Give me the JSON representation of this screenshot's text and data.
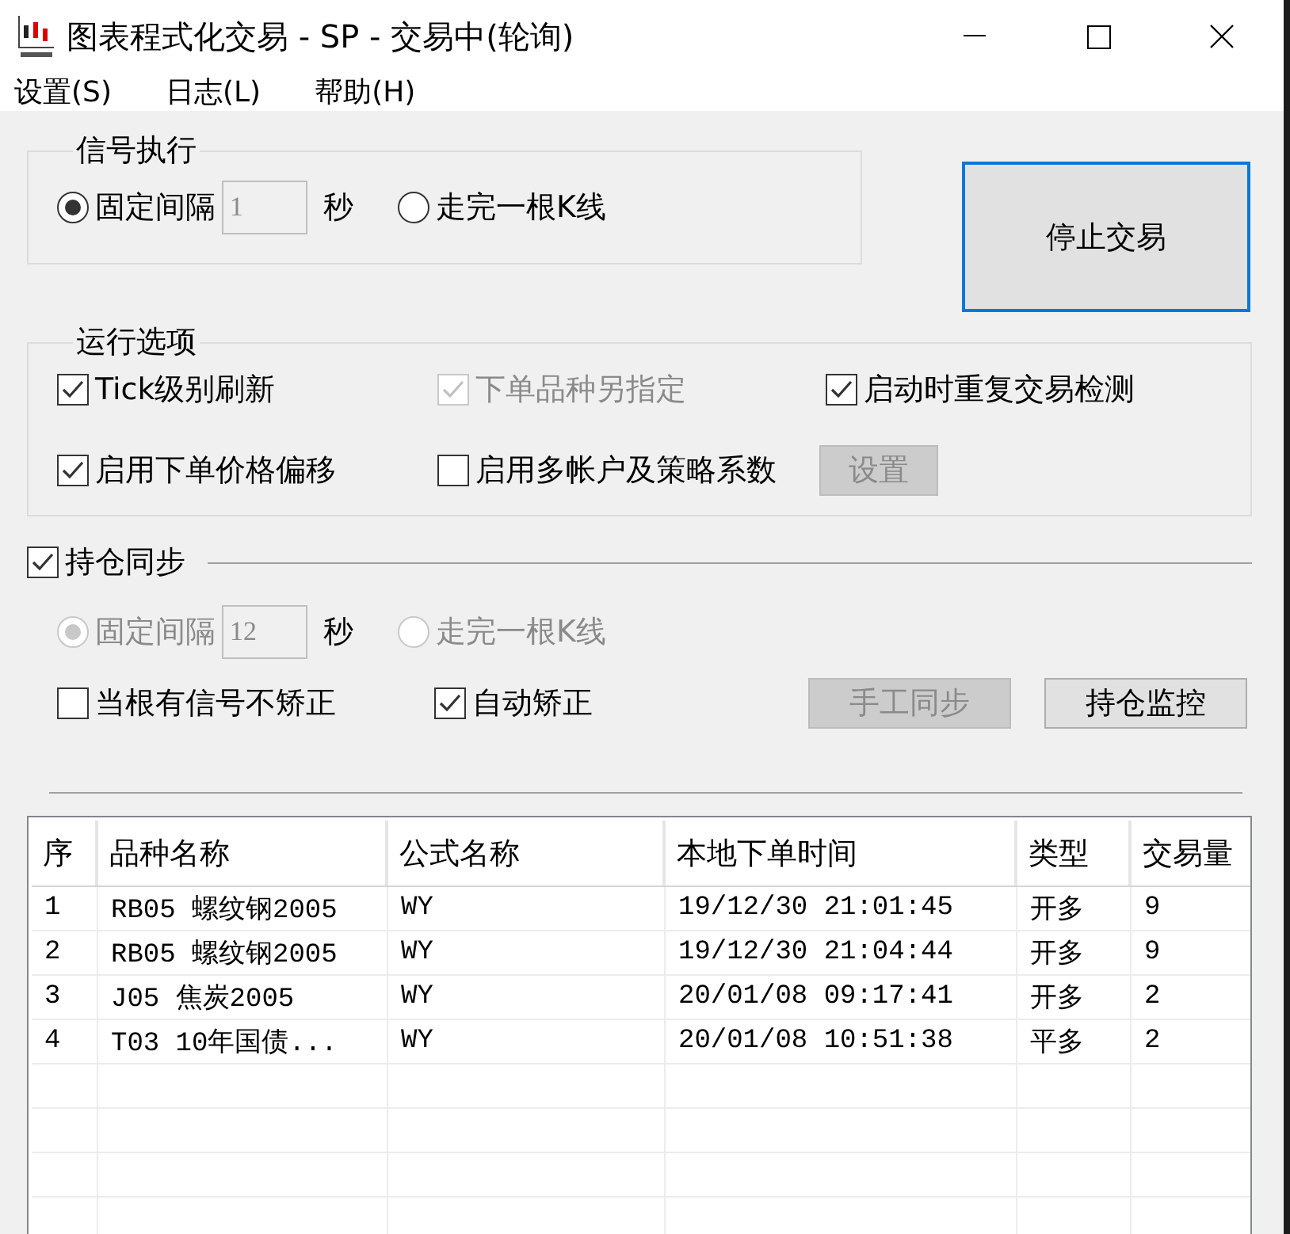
{
  "window": {
    "title": "图表程式化交易 - SP - 交易中(轮询)"
  },
  "menu": [
    "设置(S)",
    "日志(L)",
    "帮助(H)"
  ],
  "signal_execution": {
    "title": "信号执行",
    "options": [
      {
        "label": "固定间隔",
        "selected": true,
        "disabled": false,
        "kind": "interval",
        "value": "1",
        "unit": "秒"
      },
      {
        "label": "走完一根K线",
        "selected": false,
        "disabled": false,
        "kind": "plain"
      }
    ]
  },
  "stop_button": {
    "label": "停止交易"
  },
  "run_options": {
    "title": "运行选项",
    "items": [
      {
        "label": "Tick级别刷新",
        "checked": true,
        "disabled": false
      },
      {
        "label": "下单品种另指定",
        "checked": true,
        "disabled": true
      },
      {
        "label": "启动时重复交易检测",
        "checked": true,
        "disabled": false
      },
      {
        "label": "启用下单价格偏移",
        "checked": true,
        "disabled": false
      },
      {
        "label": "启用多帐户及策略系数",
        "checked": false,
        "disabled": false
      }
    ],
    "settings_button": {
      "label": "设置",
      "disabled": true
    }
  },
  "position_sync": {
    "label": "持仓同步",
    "checked": true,
    "options": [
      {
        "label": "固定间隔",
        "selected": true,
        "disabled": true,
        "kind": "interval",
        "value": "12",
        "unit": "秒"
      },
      {
        "label": "走完一根K线",
        "selected": false,
        "disabled": true,
        "kind": "plain"
      }
    ],
    "checks": [
      {
        "label": "当根有信号不矫正",
        "checked": false,
        "disabled": false
      },
      {
        "label": "自动矫正",
        "checked": true,
        "disabled": false
      }
    ],
    "buttons": [
      {
        "label": "手工同步",
        "disabled": true
      },
      {
        "label": "持仓监控",
        "disabled": false
      }
    ]
  },
  "table": {
    "columns": [
      "序",
      "品种名称",
      "公式名称",
      "本地下单时间",
      "类型",
      "交易量"
    ],
    "rows": [
      [
        "1",
        "RB05 螺纹钢2005",
        "WY",
        "19/12/30 21:01:45",
        "开多",
        "9"
      ],
      [
        "2",
        "RB05 螺纹钢2005",
        "WY",
        "19/12/30 21:04:44",
        "开多",
        "9"
      ],
      [
        "3",
        "J05 焦炭2005",
        "WY",
        "20/01/08 09:17:41",
        "开多",
        "2"
      ],
      [
        "4",
        "T03 10年国债...",
        "WY",
        "20/01/08 10:51:38",
        "平多",
        "2"
      ]
    ]
  }
}
